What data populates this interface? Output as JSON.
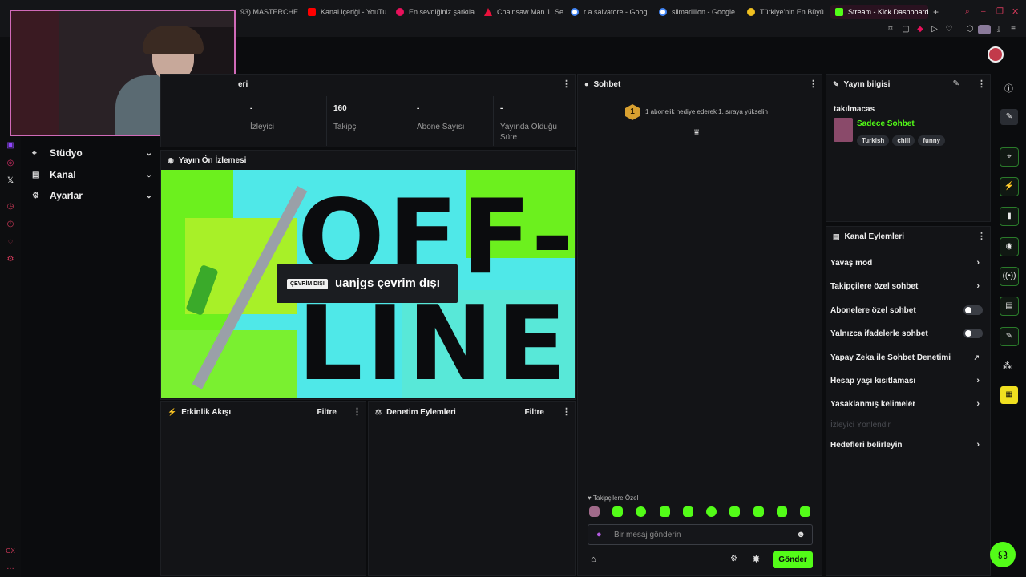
{
  "browser": {
    "tabs": [
      {
        "label": "93) MASTERCHEF",
        "color": "#e0e0e0"
      },
      {
        "label": "Kanal içeriği - YouTu",
        "color": "#ff0000"
      },
      {
        "label": "En sevdiğiniz şarkıla",
        "color": "#e8115b"
      },
      {
        "label": "Chainsaw Man 1. Se",
        "color": "#e8113b"
      },
      {
        "label": "r a salvatore - Googl",
        "color": "#4285f4"
      },
      {
        "label": "silmarillion - Google",
        "color": "#4285f4"
      },
      {
        "label": "Türkiye'nin En Büyü",
        "color": "#f0c020"
      },
      {
        "label": "Stream - Kick Dashboard",
        "color": "#53fc18"
      }
    ],
    "new_tab": "+"
  },
  "sidebar": {
    "items": [
      {
        "label": "Stüdyo",
        "icon": "⌖"
      },
      {
        "label": "Kanal",
        "icon": "▤"
      },
      {
        "label": "Ayarlar",
        "icon": "⚙"
      }
    ]
  },
  "stats_panel": {
    "title_fragment": "eri",
    "stats": [
      {
        "value": "-",
        "label": "İzleyici"
      },
      {
        "value": "160",
        "label": "Takipçi"
      },
      {
        "value": "-",
        "label": "Abone Sayısı"
      },
      {
        "value": "-",
        "label": "Yayında Olduğu Süre"
      }
    ]
  },
  "preview": {
    "title": "Yayın Ön İzlemesi",
    "badge": "ÇEVRİM DIŞI",
    "status_text": "uanjgs çevrim dışı",
    "art_line1": "OFF-",
    "art_line2": "LINE"
  },
  "activity": {
    "title": "Etkinlik Akışı",
    "filter": "Filtre"
  },
  "moderation": {
    "title": "Denetim Eylemleri",
    "filter": "Filtre"
  },
  "chat": {
    "title": "Sohbet",
    "gift_rank": "1",
    "gift_text": "1 abonelik hediye ederek 1. sıraya yükselin",
    "followers_only": "Takipçilere Özel",
    "input_placeholder": "Bir mesaj gönderin",
    "send_label": "Gönder"
  },
  "stream_info": {
    "title": "Yayın bilgisi",
    "stream_title": "takılmacas",
    "category": "Sadece Sohbet",
    "tags": [
      "Turkish",
      "chill",
      "funny"
    ]
  },
  "channel_actions": {
    "title": "Kanal Eylemleri",
    "items": [
      {
        "label": "Yavaş mod",
        "control": "chevron"
      },
      {
        "label": "Takipçilere özel sohbet",
        "control": "chevron"
      },
      {
        "label": "Abonelere özel sohbet",
        "control": "toggle"
      },
      {
        "label": "Yalnızca ifadelerle sohbet",
        "control": "toggle"
      },
      {
        "label": "Yapay Zeka ile Sohbet Denetimi",
        "control": "external"
      },
      {
        "label": "Hesap yaşı kısıtlaması",
        "control": "chevron"
      },
      {
        "label": "Yasaklanmış kelimeler",
        "control": "chevron"
      },
      {
        "label": "İzleyici Yönlendir",
        "control": "disabled"
      },
      {
        "label": "Hedefleri belirleyin",
        "control": "chevron"
      }
    ]
  },
  "colors": {
    "accent": "#53fc18",
    "bg": "#0b0c0e",
    "panel": "#131417"
  }
}
